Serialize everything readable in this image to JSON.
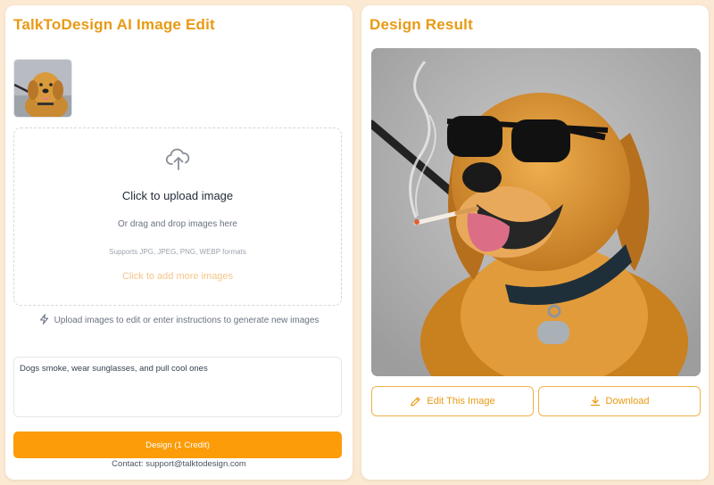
{
  "editor": {
    "title": "TalkToDesign AI Image Edit",
    "upload": {
      "title": "Click to upload image",
      "subtitle": "Or drag and drop images here",
      "formats": "Supports JPG, JPEG, PNG, WEBP formats",
      "add_more": "Click to add more images"
    },
    "hint": "Upload images to edit or enter instructions to generate new images",
    "prompt": {
      "value": "Dogs smoke, wear sunglasses, and pull cool ones"
    },
    "design_button": "Design (1 Credit)",
    "contact": "Contact: support@talktodesign.com"
  },
  "result": {
    "title": "Design Result",
    "edit_button": "Edit This Image",
    "download_button": "Download"
  },
  "colors": {
    "accent": "#e89a14",
    "button": "#fb9c08",
    "background": "#fbe9d3"
  },
  "icons": {
    "upload": "upload-cloud-icon",
    "hint": "lightning-icon",
    "edit": "pencil-icon",
    "download": "download-icon"
  }
}
